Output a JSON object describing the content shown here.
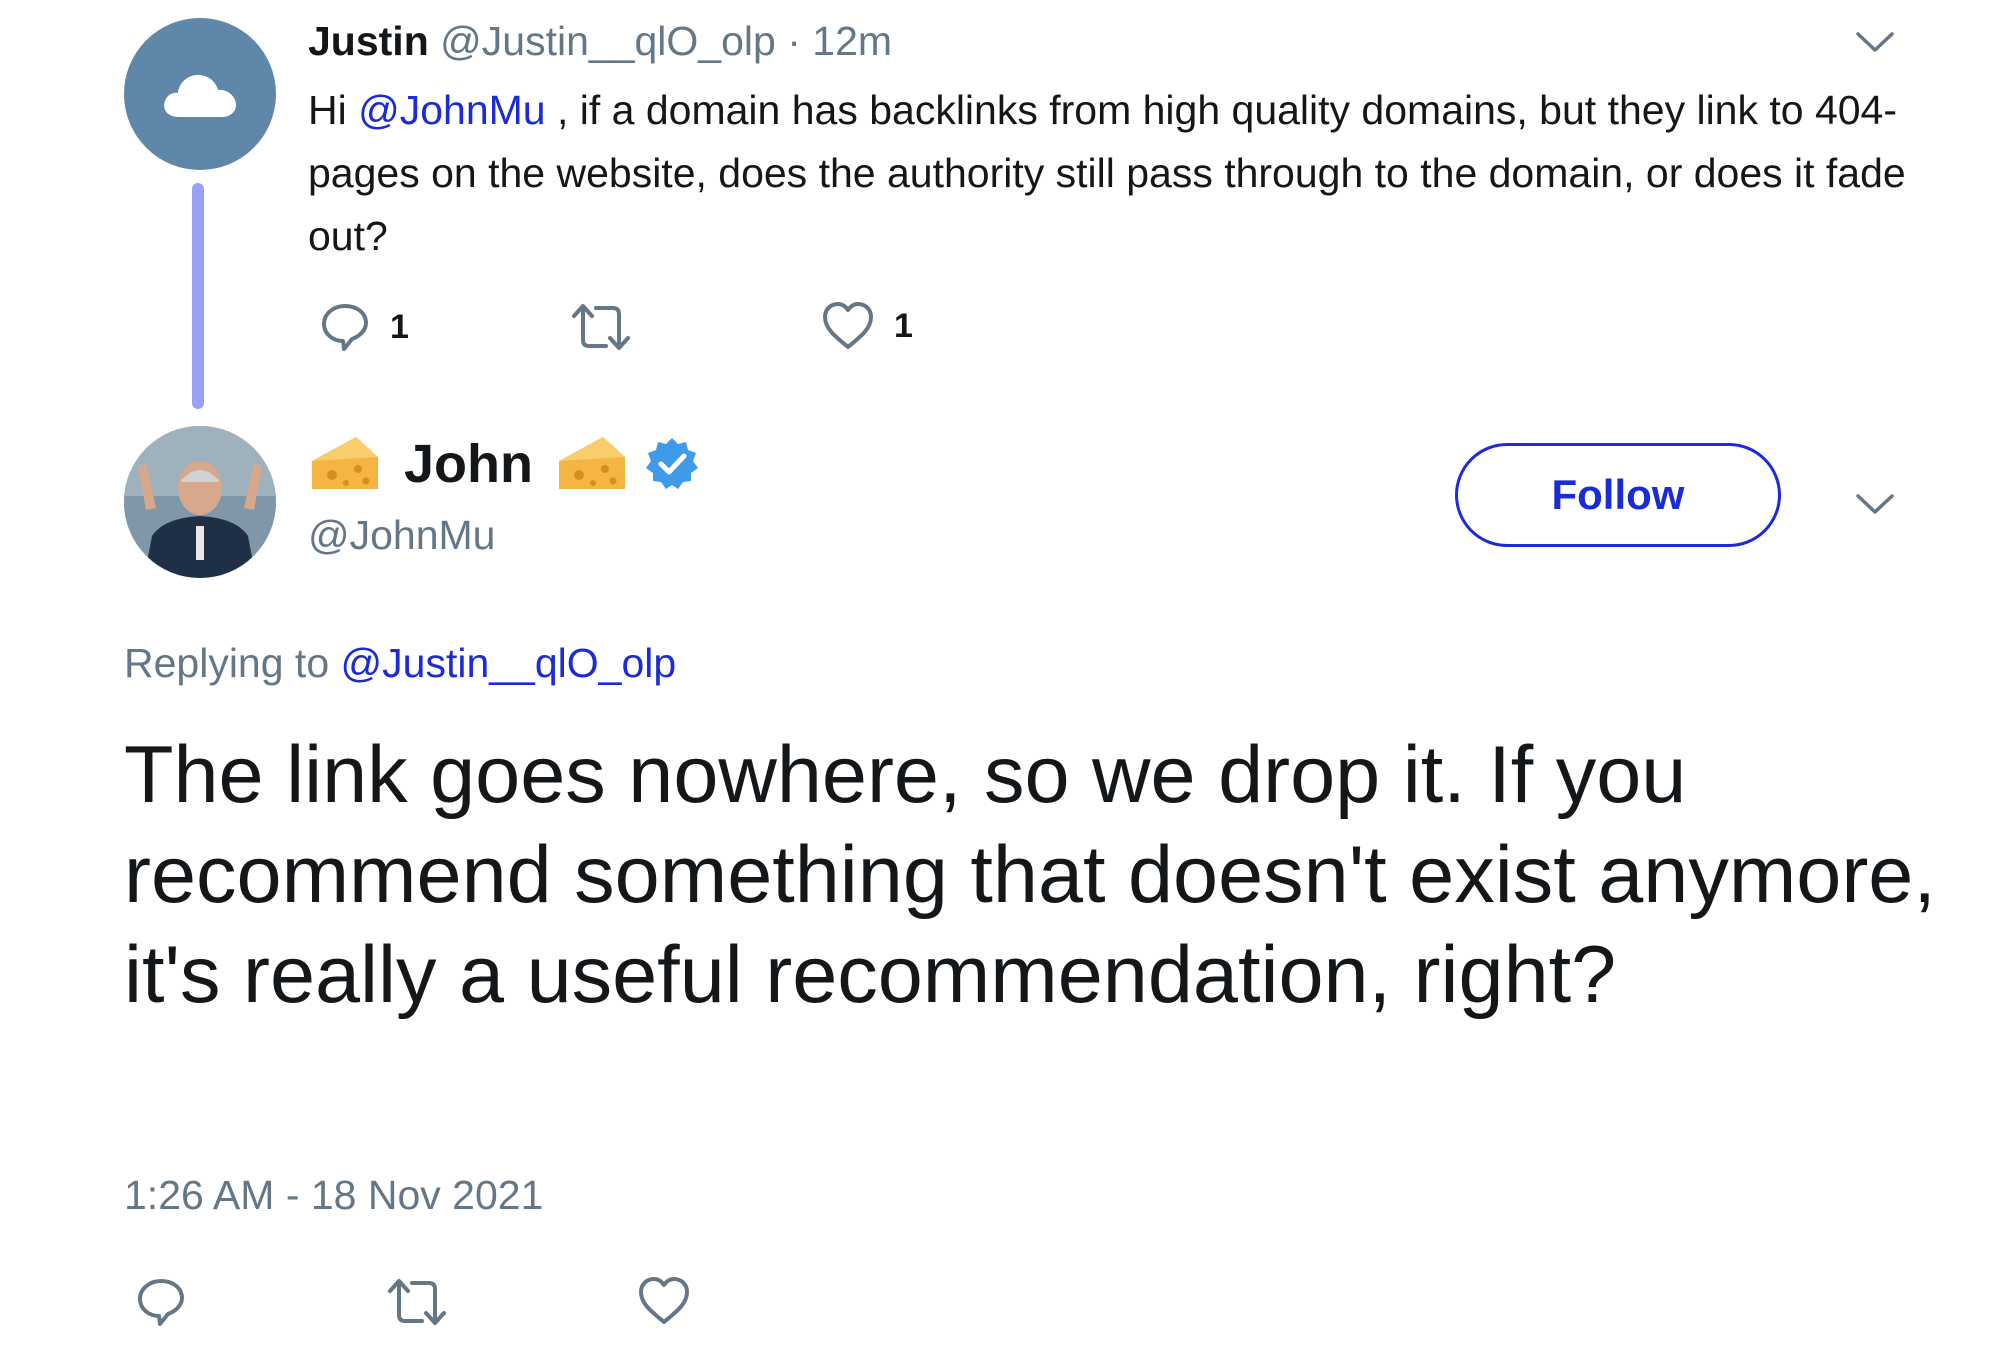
{
  "parent_tweet": {
    "name": "Justin",
    "handle": "@Justin__qlO_olp",
    "separator": "·",
    "time": "12m",
    "text_prefix": "Hi ",
    "mention": "@JohnMu",
    "text_rest": " , if a domain has backlinks from high quality domains, but they link to 404-pages on the website, does the authority still pass through to the domain, or does it fade out?",
    "reply_count": "1",
    "like_count": "1",
    "avatar_icon": "cloud-icon"
  },
  "reply_tweet": {
    "name": "John",
    "name_emoji": "cheese-icon",
    "verified_icon": "verified-badge-icon",
    "handle": "@JohnMu",
    "follow_label": "Follow",
    "replying_label": "Replying to",
    "replying_handle": "@Justin__qlO_olp",
    "text": "The link goes nowhere, so we drop it. If you recommend something that doesn't exist anymore, it's really a useful recommendation, right?",
    "timestamp": "1:26 AM - 18 Nov 2021"
  },
  "colors": {
    "link": "#1b2bd6",
    "muted": "#657786",
    "thread_line": "#9aa0f5",
    "avatar_bg": "#5e87a9"
  }
}
